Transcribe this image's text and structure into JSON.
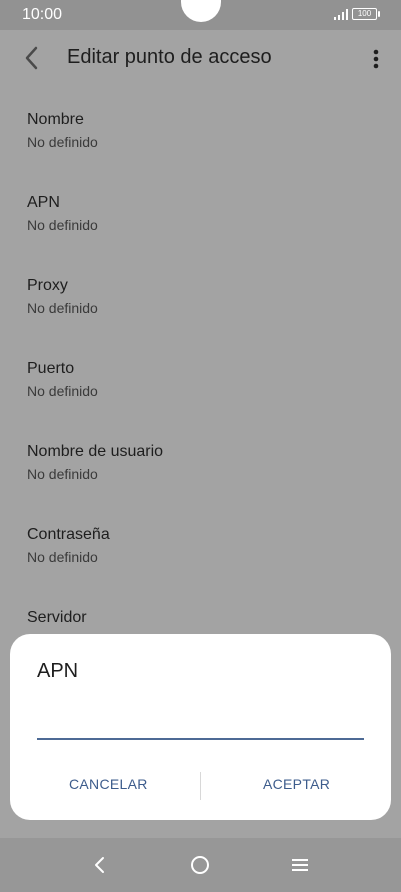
{
  "status_bar": {
    "time": "10:00",
    "battery": "100"
  },
  "header": {
    "title": "Editar punto de acceso"
  },
  "settings": [
    {
      "label": "Nombre",
      "value": "No definido"
    },
    {
      "label": "APN",
      "value": "No definido"
    },
    {
      "label": "Proxy",
      "value": "No definido"
    },
    {
      "label": "Puerto",
      "value": "No definido"
    },
    {
      "label": "Nombre de usuario",
      "value": "No definido"
    },
    {
      "label": "Contraseña",
      "value": "No definido"
    },
    {
      "label": "Servidor",
      "value": ""
    }
  ],
  "dialog": {
    "title": "APN",
    "input_value": "",
    "cancel_label": "CANCELAR",
    "accept_label": "ACEPTAR"
  },
  "icons": {
    "back": "back-arrow-icon",
    "more": "more-vertical-icon",
    "nav_back": "nav-back-icon",
    "nav_home": "nav-home-icon",
    "nav_recent": "nav-recent-icon"
  },
  "colors": {
    "accent": "#3d5c8c",
    "input_underline": "#4d6a95",
    "scrim_background": "#a3a3a3"
  }
}
